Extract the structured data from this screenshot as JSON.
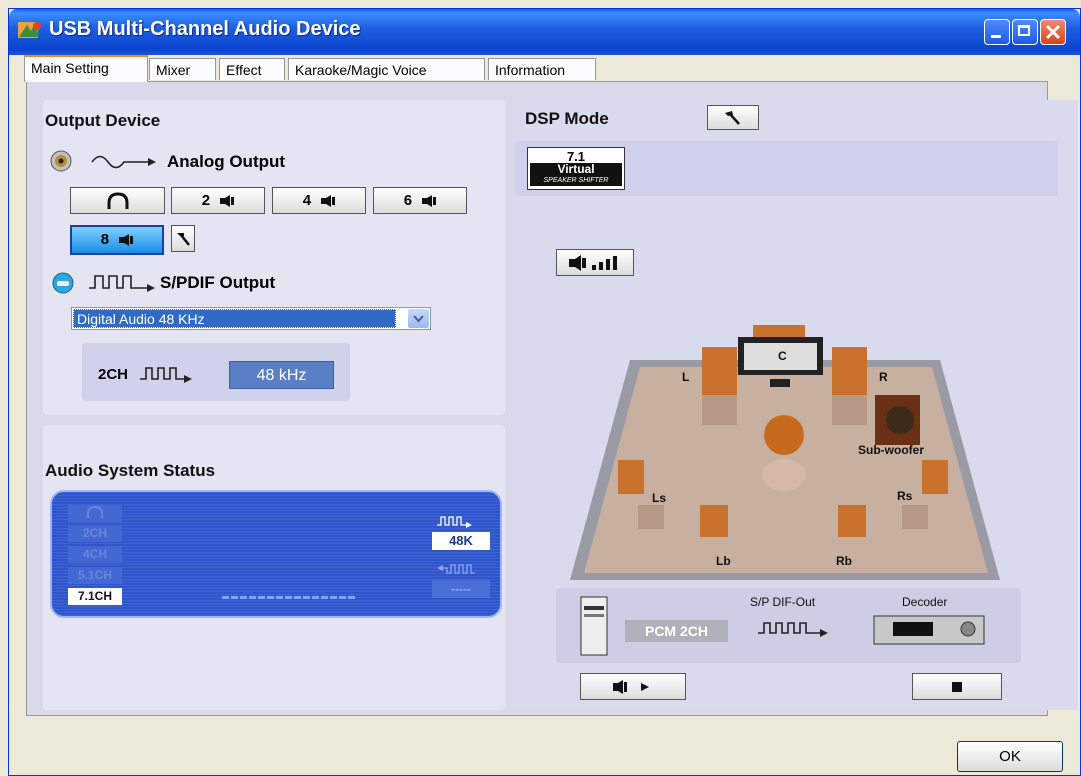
{
  "window": {
    "title": "USB Multi-Channel Audio Device"
  },
  "tabs": [
    {
      "label": "Main Setting",
      "active": true
    },
    {
      "label": "Mixer",
      "active": false
    },
    {
      "label": "Effect",
      "active": false
    },
    {
      "label": "Karaoke/Magic Voice",
      "active": false
    },
    {
      "label": "Information",
      "active": false
    }
  ],
  "output_device": {
    "title": "Output Device",
    "analog_label": "Analog Output",
    "buttons": [
      {
        "label": "",
        "icon": "headphones-icon"
      },
      {
        "label": "2",
        "icon": "speaker-icon"
      },
      {
        "label": "4",
        "icon": "speaker-icon"
      },
      {
        "label": "6",
        "icon": "speaker-icon"
      },
      {
        "label": "8",
        "icon": "speaker-icon",
        "selected": true
      }
    ],
    "spdif_label": "S/PDIF Output",
    "spdif_select": "Digital Audio 48 KHz",
    "spdif_channel": "2CH",
    "spdif_rate": "48 kHz"
  },
  "status": {
    "title": "Audio System Status",
    "channels": [
      "2CH",
      "4CH",
      "5.1CH",
      "7.1CH"
    ],
    "active_channel": "7.1CH",
    "rate": "48K",
    "input_rate": "-----"
  },
  "dsp": {
    "title": "DSP Mode",
    "virtual_top": "7.1",
    "virtual_mid": "Virtual",
    "virtual_bottom": "SPEAKER SHIFTER",
    "speakers": {
      "center": "C",
      "left": "L",
      "right": "R",
      "sub": "Sub-woofer",
      "ls": "Ls",
      "rs": "Rs",
      "lb": "Lb",
      "rb": "Rb"
    },
    "pcm_label": "PCM 2CH",
    "spdif_out": "S/P DIF-Out",
    "decoder": "Decoder"
  },
  "footer": {
    "ok": "OK"
  },
  "colors": {
    "title_bar": "#1e61e0",
    "panel_bg": "#d9d9ea",
    "selected_btn": "#1a8ce8",
    "status_bg": "#2f56cc"
  }
}
